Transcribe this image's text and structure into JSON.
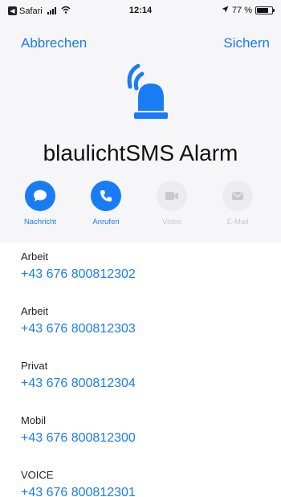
{
  "status_bar": {
    "back_app": "Safari",
    "time": "12:14",
    "battery": "77 %",
    "battery_level": 0.77
  },
  "nav": {
    "cancel": "Abbrechen",
    "save": "Sichern"
  },
  "contact": {
    "name": "blaulichtSMS Alarm",
    "avatar_icon": "siren-icon"
  },
  "colors": {
    "accent": "#1a7cf5",
    "background_top": "#f6f6f8",
    "disabled": "#c9c9cd"
  },
  "actions": [
    {
      "label": "Nachricht",
      "icon": "message-icon",
      "enabled": true
    },
    {
      "label": "Anrufen",
      "icon": "phone-icon",
      "enabled": true
    },
    {
      "label": "Video",
      "icon": "video-icon",
      "enabled": false
    },
    {
      "label": "E-Mail",
      "icon": "mail-icon",
      "enabled": false
    }
  ],
  "phone_numbers": [
    {
      "type": "Arbeit",
      "number": "+43 676 800812302"
    },
    {
      "type": "Arbeit",
      "number": "+43 676 800812303"
    },
    {
      "type": "Privat",
      "number": "+43 676 800812304"
    },
    {
      "type": "Mobil",
      "number": "+43 676 800812300"
    },
    {
      "type": "VOICE",
      "number": "+43 676 800812301"
    }
  ]
}
